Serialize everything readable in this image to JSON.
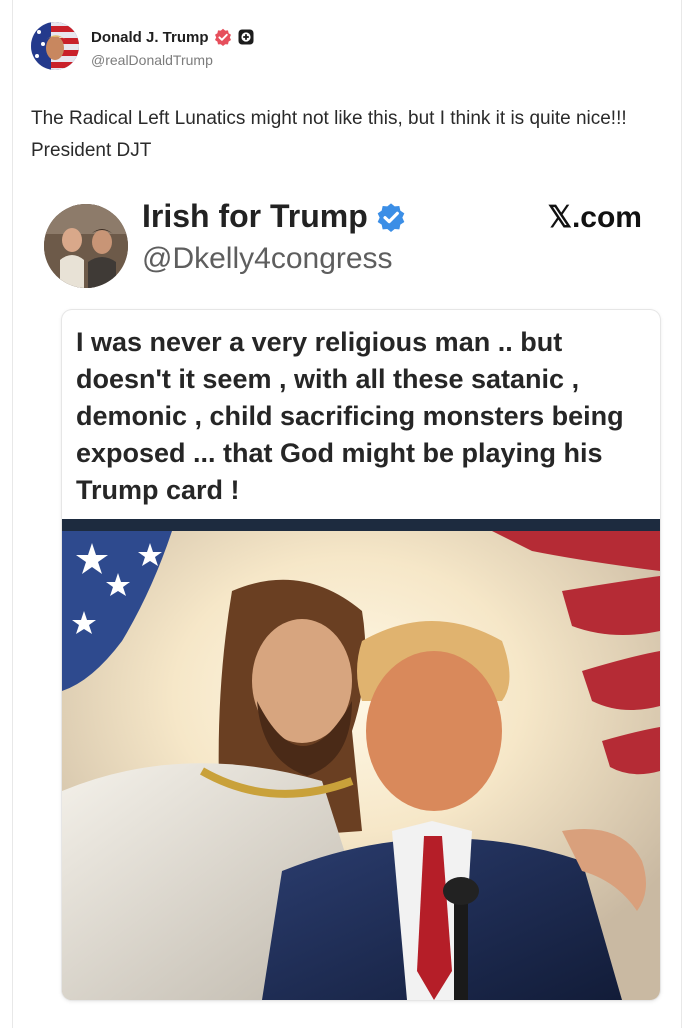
{
  "post": {
    "author": {
      "display_name": "Donald J. Trump",
      "handle": "@realDonaldTrump",
      "verified_icon": "verified-badge-icon",
      "plus_icon": "plus-badge-icon"
    },
    "text": "The Radical Left Lunatics might not like this, but I think it is quite nice!!!  President DJT"
  },
  "embed": {
    "account_name": "Irish for Trump",
    "handle": "@Dkelly4congress",
    "site": "𝕏.com",
    "quote": "I was never a very religious man .. but doesn't it seem , with all these satanic , demonic , child sacrificing monsters being exposed ... that God might be playing his Trump card !"
  },
  "colors": {
    "verified_badge": "#e64f5c",
    "embed_verified_badge": "#3b8ee6",
    "divider": "#1d2b3f"
  }
}
